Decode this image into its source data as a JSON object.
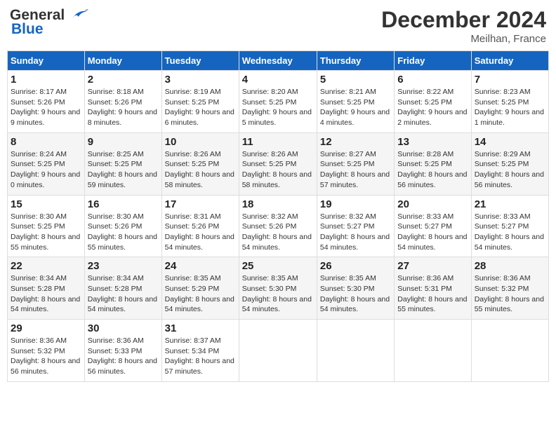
{
  "header": {
    "logo_line1": "General",
    "logo_line2": "Blue",
    "month": "December 2024",
    "location": "Meilhan, France"
  },
  "weekdays": [
    "Sunday",
    "Monday",
    "Tuesday",
    "Wednesday",
    "Thursday",
    "Friday",
    "Saturday"
  ],
  "weeks": [
    [
      {
        "day": "1",
        "sunrise": "Sunrise: 8:17 AM",
        "sunset": "Sunset: 5:26 PM",
        "daylight": "Daylight: 9 hours and 9 minutes."
      },
      {
        "day": "2",
        "sunrise": "Sunrise: 8:18 AM",
        "sunset": "Sunset: 5:26 PM",
        "daylight": "Daylight: 9 hours and 8 minutes."
      },
      {
        "day": "3",
        "sunrise": "Sunrise: 8:19 AM",
        "sunset": "Sunset: 5:25 PM",
        "daylight": "Daylight: 9 hours and 6 minutes."
      },
      {
        "day": "4",
        "sunrise": "Sunrise: 8:20 AM",
        "sunset": "Sunset: 5:25 PM",
        "daylight": "Daylight: 9 hours and 5 minutes."
      },
      {
        "day": "5",
        "sunrise": "Sunrise: 8:21 AM",
        "sunset": "Sunset: 5:25 PM",
        "daylight": "Daylight: 9 hours and 4 minutes."
      },
      {
        "day": "6",
        "sunrise": "Sunrise: 8:22 AM",
        "sunset": "Sunset: 5:25 PM",
        "daylight": "Daylight: 9 hours and 2 minutes."
      },
      {
        "day": "7",
        "sunrise": "Sunrise: 8:23 AM",
        "sunset": "Sunset: 5:25 PM",
        "daylight": "Daylight: 9 hours and 1 minute."
      }
    ],
    [
      {
        "day": "8",
        "sunrise": "Sunrise: 8:24 AM",
        "sunset": "Sunset: 5:25 PM",
        "daylight": "Daylight: 9 hours and 0 minutes."
      },
      {
        "day": "9",
        "sunrise": "Sunrise: 8:25 AM",
        "sunset": "Sunset: 5:25 PM",
        "daylight": "Daylight: 8 hours and 59 minutes."
      },
      {
        "day": "10",
        "sunrise": "Sunrise: 8:26 AM",
        "sunset": "Sunset: 5:25 PM",
        "daylight": "Daylight: 8 hours and 58 minutes."
      },
      {
        "day": "11",
        "sunrise": "Sunrise: 8:26 AM",
        "sunset": "Sunset: 5:25 PM",
        "daylight": "Daylight: 8 hours and 58 minutes."
      },
      {
        "day": "12",
        "sunrise": "Sunrise: 8:27 AM",
        "sunset": "Sunset: 5:25 PM",
        "daylight": "Daylight: 8 hours and 57 minutes."
      },
      {
        "day": "13",
        "sunrise": "Sunrise: 8:28 AM",
        "sunset": "Sunset: 5:25 PM",
        "daylight": "Daylight: 8 hours and 56 minutes."
      },
      {
        "day": "14",
        "sunrise": "Sunrise: 8:29 AM",
        "sunset": "Sunset: 5:25 PM",
        "daylight": "Daylight: 8 hours and 56 minutes."
      }
    ],
    [
      {
        "day": "15",
        "sunrise": "Sunrise: 8:30 AM",
        "sunset": "Sunset: 5:25 PM",
        "daylight": "Daylight: 8 hours and 55 minutes."
      },
      {
        "day": "16",
        "sunrise": "Sunrise: 8:30 AM",
        "sunset": "Sunset: 5:26 PM",
        "daylight": "Daylight: 8 hours and 55 minutes."
      },
      {
        "day": "17",
        "sunrise": "Sunrise: 8:31 AM",
        "sunset": "Sunset: 5:26 PM",
        "daylight": "Daylight: 8 hours and 54 minutes."
      },
      {
        "day": "18",
        "sunrise": "Sunrise: 8:32 AM",
        "sunset": "Sunset: 5:26 PM",
        "daylight": "Daylight: 8 hours and 54 minutes."
      },
      {
        "day": "19",
        "sunrise": "Sunrise: 8:32 AM",
        "sunset": "Sunset: 5:27 PM",
        "daylight": "Daylight: 8 hours and 54 minutes."
      },
      {
        "day": "20",
        "sunrise": "Sunrise: 8:33 AM",
        "sunset": "Sunset: 5:27 PM",
        "daylight": "Daylight: 8 hours and 54 minutes."
      },
      {
        "day": "21",
        "sunrise": "Sunrise: 8:33 AM",
        "sunset": "Sunset: 5:27 PM",
        "daylight": "Daylight: 8 hours and 54 minutes."
      }
    ],
    [
      {
        "day": "22",
        "sunrise": "Sunrise: 8:34 AM",
        "sunset": "Sunset: 5:28 PM",
        "daylight": "Daylight: 8 hours and 54 minutes."
      },
      {
        "day": "23",
        "sunrise": "Sunrise: 8:34 AM",
        "sunset": "Sunset: 5:28 PM",
        "daylight": "Daylight: 8 hours and 54 minutes."
      },
      {
        "day": "24",
        "sunrise": "Sunrise: 8:35 AM",
        "sunset": "Sunset: 5:29 PM",
        "daylight": "Daylight: 8 hours and 54 minutes."
      },
      {
        "day": "25",
        "sunrise": "Sunrise: 8:35 AM",
        "sunset": "Sunset: 5:30 PM",
        "daylight": "Daylight: 8 hours and 54 minutes."
      },
      {
        "day": "26",
        "sunrise": "Sunrise: 8:35 AM",
        "sunset": "Sunset: 5:30 PM",
        "daylight": "Daylight: 8 hours and 54 minutes."
      },
      {
        "day": "27",
        "sunrise": "Sunrise: 8:36 AM",
        "sunset": "Sunset: 5:31 PM",
        "daylight": "Daylight: 8 hours and 55 minutes."
      },
      {
        "day": "28",
        "sunrise": "Sunrise: 8:36 AM",
        "sunset": "Sunset: 5:32 PM",
        "daylight": "Daylight: 8 hours and 55 minutes."
      }
    ],
    [
      {
        "day": "29",
        "sunrise": "Sunrise: 8:36 AM",
        "sunset": "Sunset: 5:32 PM",
        "daylight": "Daylight: 8 hours and 56 minutes."
      },
      {
        "day": "30",
        "sunrise": "Sunrise: 8:36 AM",
        "sunset": "Sunset: 5:33 PM",
        "daylight": "Daylight: 8 hours and 56 minutes."
      },
      {
        "day": "31",
        "sunrise": "Sunrise: 8:37 AM",
        "sunset": "Sunset: 5:34 PM",
        "daylight": "Daylight: 8 hours and 57 minutes."
      },
      null,
      null,
      null,
      null
    ]
  ]
}
